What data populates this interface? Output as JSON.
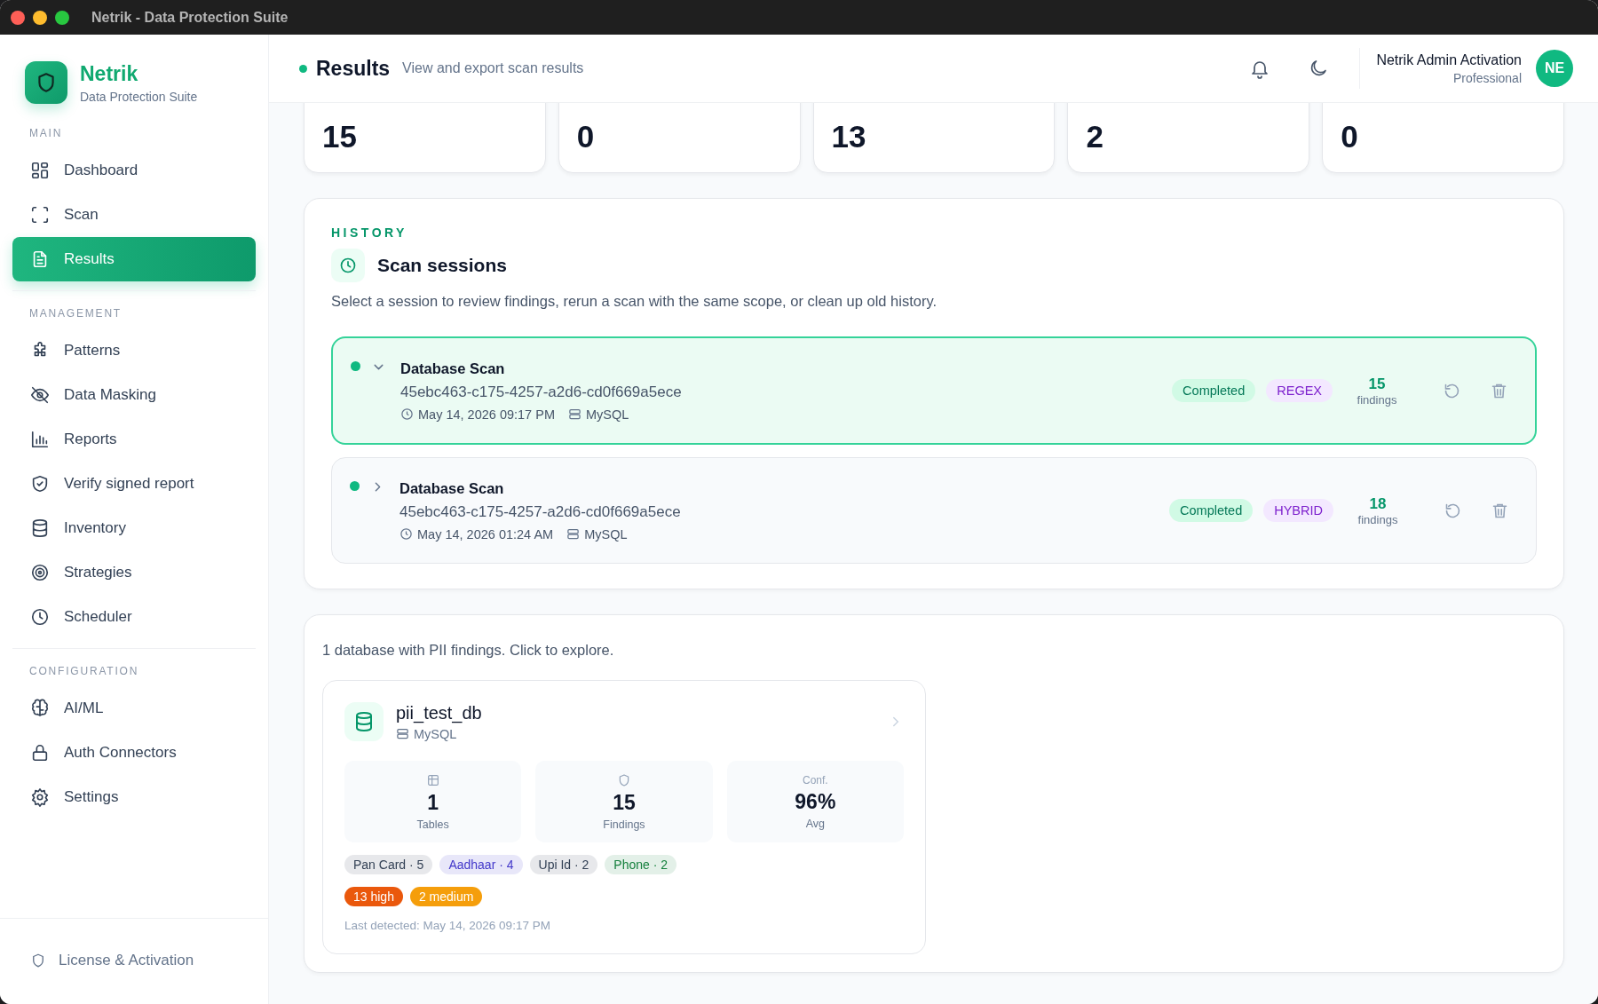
{
  "window": {
    "title": "Netrik - Data Protection Suite"
  },
  "sidebar": {
    "brand": {
      "name": "Netrik",
      "subtitle": "Data Protection Suite"
    },
    "sections": [
      {
        "heading": "MAIN",
        "items": [
          {
            "label": "Dashboard",
            "selected": false
          },
          {
            "label": "Scan",
            "selected": false
          },
          {
            "label": "Results",
            "selected": true
          }
        ]
      },
      {
        "heading": "MANAGEMENT",
        "items": [
          {
            "label": "Patterns",
            "selected": false
          },
          {
            "label": "Data Masking",
            "selected": false
          },
          {
            "label": "Reports",
            "selected": false
          },
          {
            "label": "Verify signed report",
            "selected": false
          },
          {
            "label": "Inventory",
            "selected": false
          },
          {
            "label": "Strategies",
            "selected": false
          },
          {
            "label": "Scheduler",
            "selected": false
          }
        ]
      },
      {
        "heading": "CONFIGURATION",
        "items": [
          {
            "label": "AI/ML",
            "selected": false
          },
          {
            "label": "Auth Connectors",
            "selected": false
          },
          {
            "label": "Settings",
            "selected": false
          }
        ]
      }
    ],
    "footer": {
      "label": "License & Activation"
    }
  },
  "header": {
    "title": "Results",
    "subtitle": "View and export scan results",
    "user": {
      "name": "Netrik Admin Activation",
      "plan": "Professional",
      "initials": "NE"
    }
  },
  "stats": [
    {
      "value": "15"
    },
    {
      "value": "0"
    },
    {
      "value": "13"
    },
    {
      "value": "2"
    },
    {
      "value": "0"
    }
  ],
  "history": {
    "eyebrow": "HISTORY",
    "title": "Scan sessions",
    "description": "Select a session to review findings, rerun a scan with the same scope, or clean up old history.",
    "sessions": [
      {
        "name": "Database Scan",
        "id": "45ebc463-c175-4257-a2d6-cd0f669a5ece",
        "date": "May 14, 2026 09:17 PM",
        "source": "MySQL",
        "status": "Completed",
        "method": "REGEX",
        "count": "15",
        "count_label": "findings",
        "expanded": true
      },
      {
        "name": "Database Scan",
        "id": "45ebc463-c175-4257-a2d6-cd0f669a5ece",
        "date": "May 14, 2026 01:24 AM",
        "source": "MySQL",
        "status": "Completed",
        "method": "HYBRID",
        "count": "18",
        "count_label": "findings",
        "expanded": false
      }
    ]
  },
  "databases": {
    "summary": "1 database with PII findings. Click to explore.",
    "cards": [
      {
        "name": "pii_test_db",
        "source": "MySQL",
        "stats": [
          {
            "kind": "tables",
            "value": "1",
            "label": "Tables"
          },
          {
            "kind": "findings",
            "value": "15",
            "label": "Findings"
          },
          {
            "kind": "caption",
            "caption": "Conf.",
            "value": "96%",
            "label": "Avg"
          }
        ],
        "tags": [
          {
            "label": "Pan Card · 5",
            "color": "#334155"
          },
          {
            "label": "Aadhaar · 4",
            "color": "#4338ca"
          },
          {
            "label": "Upi Id · 2",
            "color": "#334155"
          },
          {
            "label": "Phone · 2",
            "color": "#15803d"
          }
        ],
        "severities": [
          {
            "label": "13 high",
            "color": "#ea580c"
          },
          {
            "label": "2 medium",
            "color": "#f59e0b"
          }
        ],
        "last_detected": "Last detected: May 14, 2026 09:17 PM"
      }
    ]
  }
}
